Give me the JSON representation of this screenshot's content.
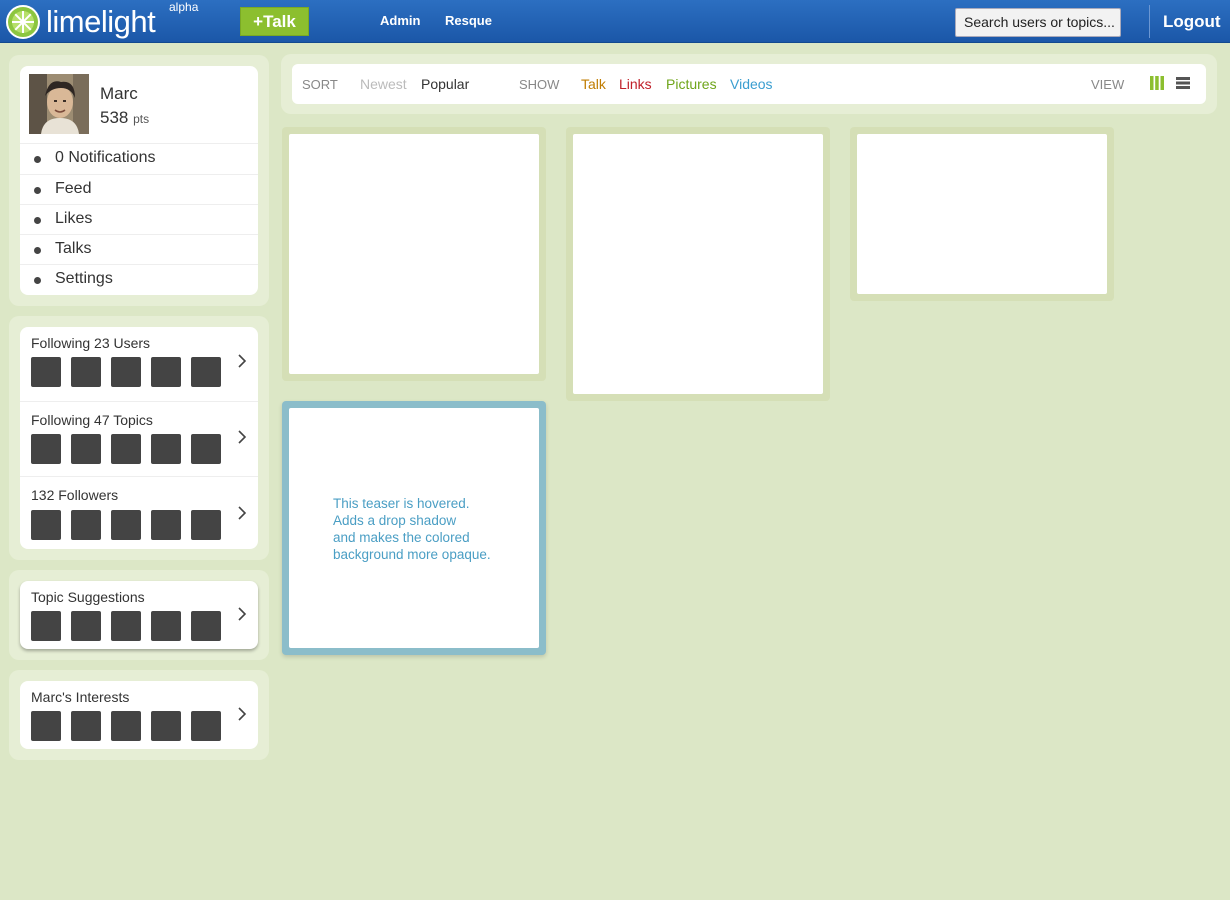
{
  "header": {
    "logo_text": "limelight",
    "logo_sup": "alpha",
    "talk_button": "+Talk",
    "nav": [
      "Admin",
      "Resque"
    ],
    "search_placeholder": "Search users or topics...",
    "logout": "Logout",
    "colors": {
      "bar": "#1f5fb2",
      "talk_button": "#8cbf2f"
    }
  },
  "profile": {
    "name": "Marc",
    "points": "538",
    "points_unit": "pts",
    "menu": [
      {
        "label": "0 Notifications"
      },
      {
        "label": "Feed"
      },
      {
        "label": "Likes"
      },
      {
        "label": "Talks"
      },
      {
        "label": "Settings"
      }
    ]
  },
  "following": {
    "users": "Following 23 Users",
    "topics": "Following 47 Topics",
    "followers": "132 Followers"
  },
  "suggestions": {
    "title": "Topic Suggestions"
  },
  "interests": {
    "title": "Marc's Interests"
  },
  "toolbar": {
    "sort_label": "SORT",
    "sort_options": [
      "Newest",
      "Popular"
    ],
    "sort_selected": "Popular",
    "show_label": "SHOW",
    "show_options": [
      {
        "label": "Talk",
        "color": "#c07c00"
      },
      {
        "label": "Links",
        "color": "#c0202a"
      },
      {
        "label": "Pictures",
        "color": "#6fa51a"
      },
      {
        "label": "Videos",
        "color": "#3a9ed0"
      }
    ],
    "view_label": "VIEW"
  },
  "teasers": {
    "hover_note": [
      "This teaser is hovered.",
      "Adds a drop shadow",
      "and makes the colored",
      "background more opaque."
    ]
  }
}
